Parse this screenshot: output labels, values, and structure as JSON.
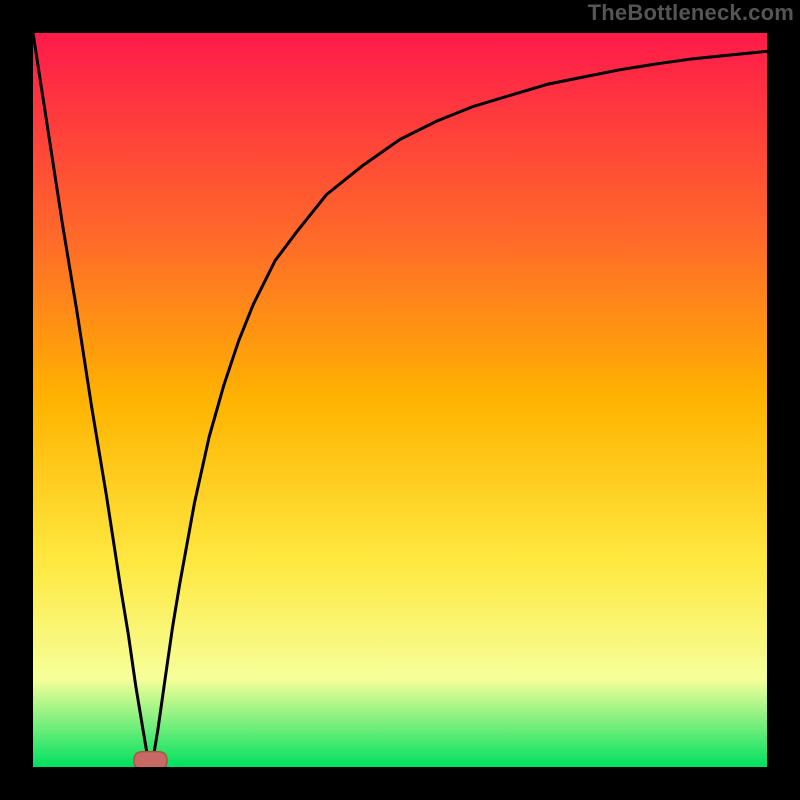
{
  "watermark": "TheBottleneck.com",
  "colors": {
    "frame": "#000000",
    "gradient_top": "#ff1a4a",
    "gradient_mid_upper": "#ff6a2a",
    "gradient_mid": "#ffb300",
    "gradient_mid_lower": "#ffe840",
    "gradient_lower": "#f6ff9a",
    "gradient_bottom": "#00e060",
    "curve": "#000000",
    "marker_fill": "#c86a63",
    "marker_stroke": "#b24f49"
  },
  "chart_data": {
    "type": "line",
    "title": "",
    "xlabel": "",
    "ylabel": "",
    "xlim": [
      0,
      100
    ],
    "ylim": [
      0,
      100
    ],
    "x": [
      0,
      2,
      4,
      6,
      8,
      10,
      12,
      13,
      14,
      15,
      15.5,
      16,
      16.5,
      17,
      18,
      19,
      20,
      22,
      24,
      26,
      28,
      30,
      33,
      36,
      40,
      45,
      50,
      55,
      60,
      65,
      70,
      75,
      80,
      85,
      90,
      95,
      100
    ],
    "y": [
      100,
      87,
      74,
      62,
      49,
      37,
      24,
      18,
      11,
      5,
      2,
      1,
      2,
      5,
      12,
      19,
      25,
      36,
      45,
      52,
      58,
      63,
      69,
      73,
      78,
      82,
      85.5,
      88,
      90,
      91.5,
      93,
      94,
      95,
      95.8,
      96.5,
      97,
      97.5
    ],
    "marker": {
      "x": 16,
      "y": 1,
      "width": 4.5
    },
    "annotations": []
  }
}
